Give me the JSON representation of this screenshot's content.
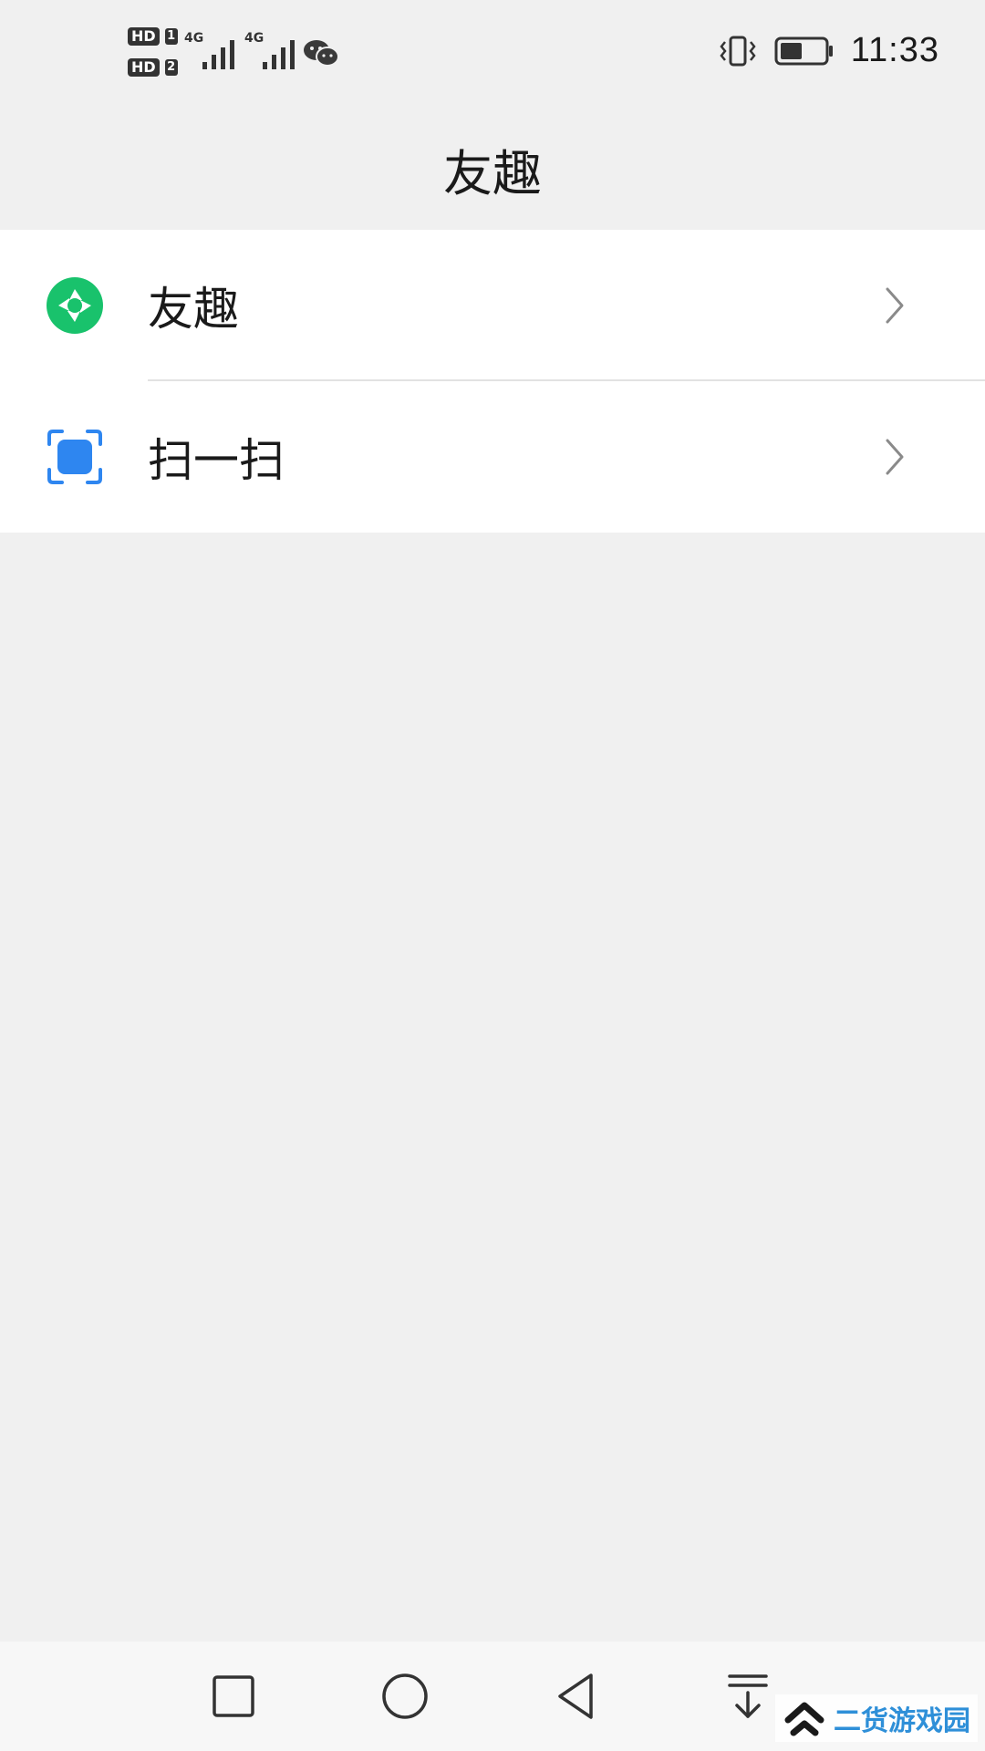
{
  "status_bar": {
    "sim1_badge": "HD",
    "sim1_number": "1",
    "sim2_badge": "HD",
    "sim2_number": "2",
    "network1": "4G",
    "network2": "4G",
    "time": "11:33",
    "icons": [
      "wechat-icon",
      "vibrate-icon",
      "battery-icon"
    ],
    "battery_level": 0.5
  },
  "header": {
    "title": "友趣"
  },
  "menu": {
    "items": [
      {
        "label": "友趣",
        "icon": "aperture-icon",
        "icon_color": "#19c26c"
      },
      {
        "label": "扫一扫",
        "icon": "scan-icon",
        "icon_color": "#2e86f0"
      }
    ]
  },
  "nav_bar": {
    "buttons": [
      "recent-apps-icon",
      "home-icon",
      "back-icon",
      "notification-pulldown-icon"
    ]
  },
  "watermark": {
    "text": "二货游戏园",
    "color": "#2e8fd8"
  }
}
